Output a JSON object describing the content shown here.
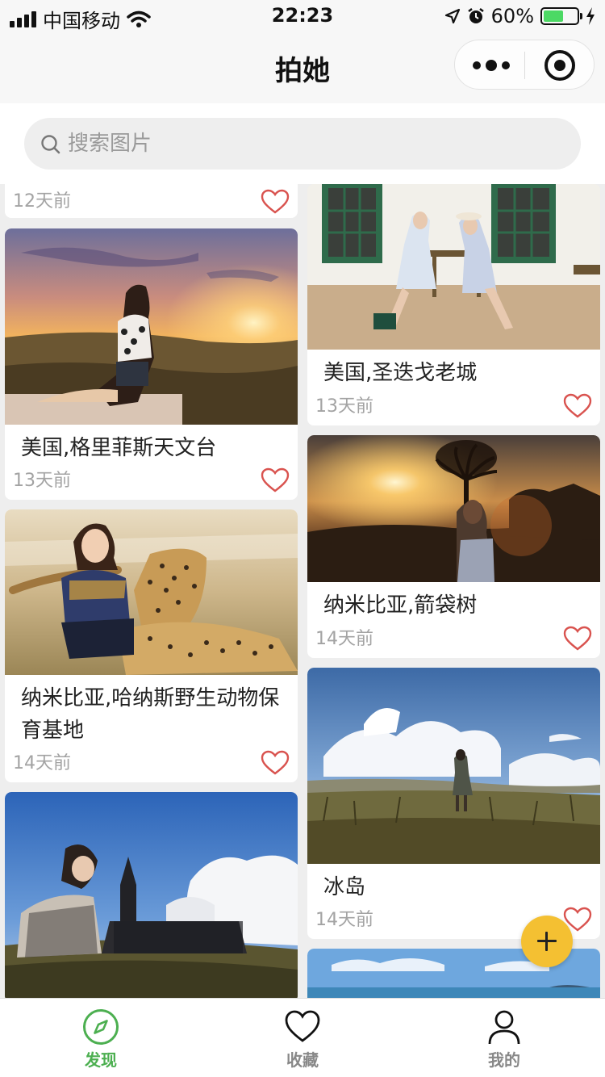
{
  "status_bar": {
    "carrier": "中国移动",
    "time": "22:23",
    "battery": "60%",
    "battery_level": 0.6,
    "icons": [
      "signal-icon",
      "wifi-icon",
      "location-icon",
      "alarm-icon",
      "battery-icon",
      "charging-icon"
    ]
  },
  "nav": {
    "title": "拍她",
    "icons": [
      "more-icon",
      "close-icon"
    ]
  },
  "search": {
    "placeholder": "搜索图片"
  },
  "feed": {
    "left_column": [
      {
        "caption": "",
        "time": "12天前",
        "liked": false
      },
      {
        "caption": "美国,格里菲斯天文台",
        "time": "13天前",
        "liked": false
      },
      {
        "caption": "纳米比亚,哈纳斯野生动物保育基地",
        "time": "14天前",
        "liked": false
      },
      {
        "caption": "",
        "time": "",
        "liked": false
      }
    ],
    "right_column": [
      {
        "caption": "美国,圣迭戈老城",
        "time": "13天前",
        "liked": false
      },
      {
        "caption": "纳米比亚,箭袋树",
        "time": "14天前",
        "liked": false
      },
      {
        "caption": "冰岛",
        "time": "14天前",
        "liked": false
      },
      {
        "caption": "",
        "time": "",
        "liked": false
      }
    ]
  },
  "fab": {
    "icon": "plus-icon"
  },
  "tab_bar": {
    "items": [
      {
        "label": "发现",
        "icon": "compass-icon",
        "active": true
      },
      {
        "label": "收藏",
        "icon": "heart-icon",
        "active": false
      },
      {
        "label": "我的",
        "icon": "user-icon",
        "active": false
      }
    ]
  },
  "colors": {
    "accent_green": "#4caf50",
    "fab_yellow": "#f4c032",
    "heart_red": "#d9534f",
    "nav_bg": "#f7f7f7",
    "feed_bg": "#eeeeee"
  }
}
